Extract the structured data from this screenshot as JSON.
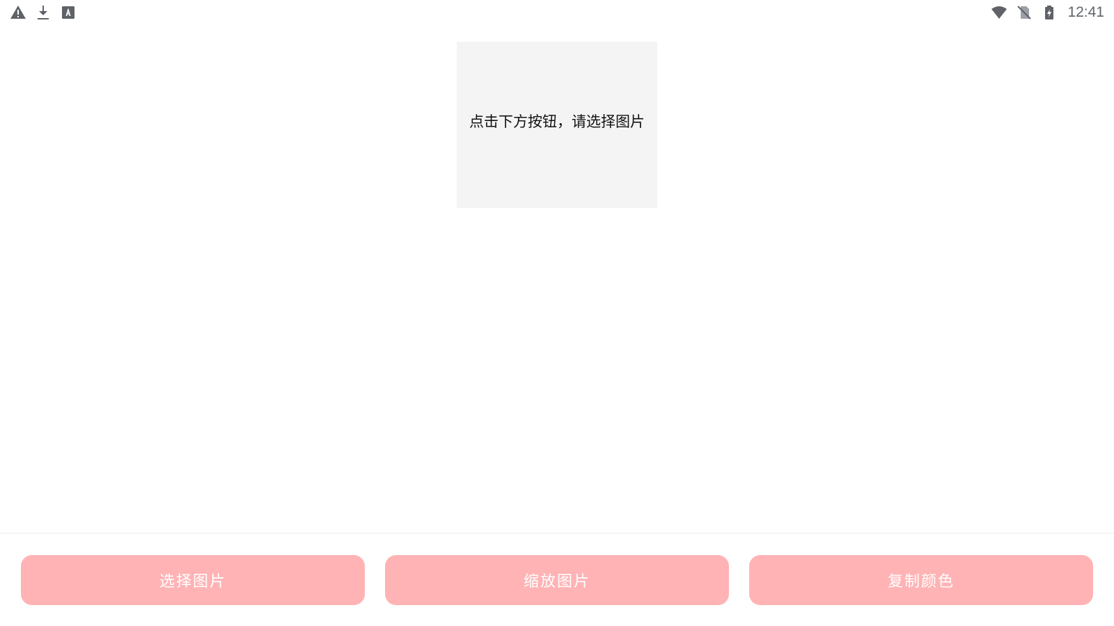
{
  "status_bar": {
    "left_icons": [
      "warning-icon",
      "download-icon",
      "text-recognition-icon"
    ],
    "right_icons": [
      "wifi-icon",
      "no-sim-icon",
      "battery-charging-icon"
    ],
    "time": "12:41"
  },
  "main": {
    "placeholder_text": "点击下方按钮，请选择图片"
  },
  "actions": {
    "select_image": "选择图片",
    "zoom_image": "缩放图片",
    "copy_color": "复制颜色"
  },
  "colors": {
    "button_background": "#ffb3b5",
    "button_text": "#ffffff",
    "panel_background": "#f4f4f4"
  }
}
